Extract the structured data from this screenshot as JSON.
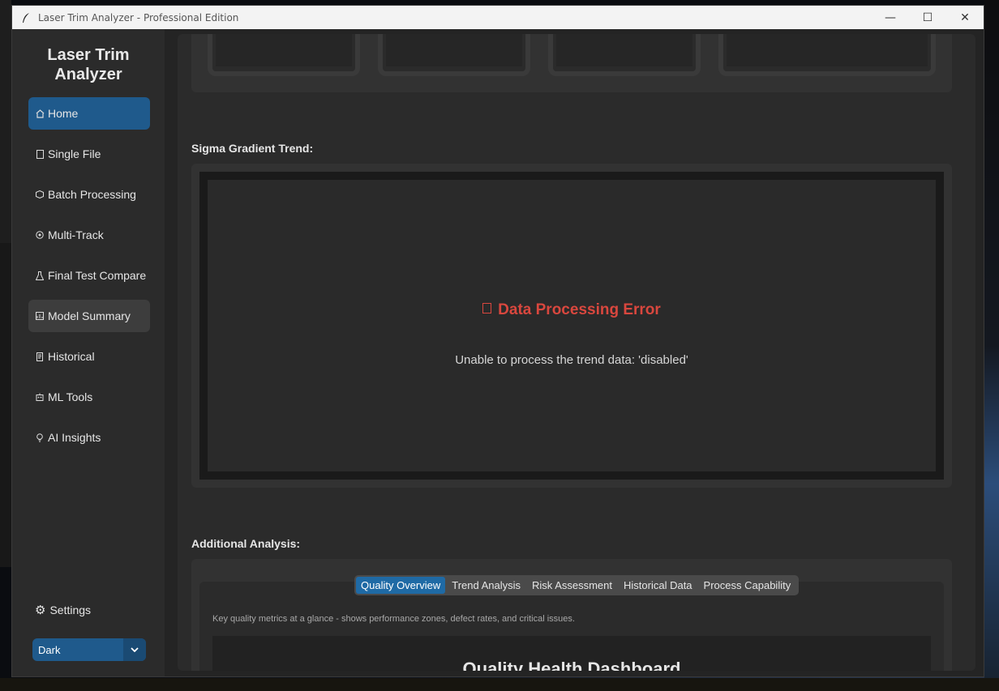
{
  "window": {
    "title": "Laser Trim Analyzer - Professional Edition",
    "minimize_glyph": "—",
    "maximize_glyph": "☐",
    "close_glyph": "✕"
  },
  "sidebar": {
    "app_title": "Laser Trim Analyzer",
    "items": [
      {
        "label": "Home",
        "icon": "home-icon",
        "glyph": "🏠"
      },
      {
        "label": "Single File",
        "icon": "file-icon",
        "glyph": "📄"
      },
      {
        "label": "Batch Processing",
        "icon": "package-icon",
        "glyph": "📦"
      },
      {
        "label": "Multi-Track",
        "icon": "target-icon",
        "glyph": "🎯"
      },
      {
        "label": "Final Test Compare",
        "icon": "flask-icon",
        "glyph": "⚗"
      },
      {
        "label": "Model Summary",
        "icon": "chart-icon",
        "glyph": "📊"
      },
      {
        "label": "Historical",
        "icon": "scroll-icon",
        "glyph": "📜"
      },
      {
        "label": "ML Tools",
        "icon": "robot-icon",
        "glyph": "🤖"
      },
      {
        "label": "AI Insights",
        "icon": "lightbulb-icon",
        "glyph": "💡"
      }
    ],
    "active_item": "Home",
    "hovered_item": "Model Summary",
    "settings_label": "Settings",
    "settings_glyph": "⚙",
    "theme_value": "Dark",
    "theme_arrow": "⌄"
  },
  "main": {
    "sigma_section_label": "Sigma Gradient Trend:",
    "error_title": "Data Processing Error",
    "error_message": "Unable to process the trend data: 'disabled'",
    "additional_section_label": "Additional Analysis:",
    "tabs": [
      {
        "label": "Quality Overview",
        "active": true
      },
      {
        "label": "Trend Analysis",
        "active": false
      },
      {
        "label": "Risk Assessment",
        "active": false
      },
      {
        "label": "Historical Data",
        "active": false
      },
      {
        "label": "Process Capability",
        "active": false
      }
    ],
    "tab_description": "Key quality metrics at a glance - shows performance zones, defect rates, and critical issues.",
    "dashboard_title": "Quality Health Dashboard"
  },
  "colors": {
    "accent": "#1f6aa5",
    "error": "#d9473e",
    "background": "#242424"
  }
}
